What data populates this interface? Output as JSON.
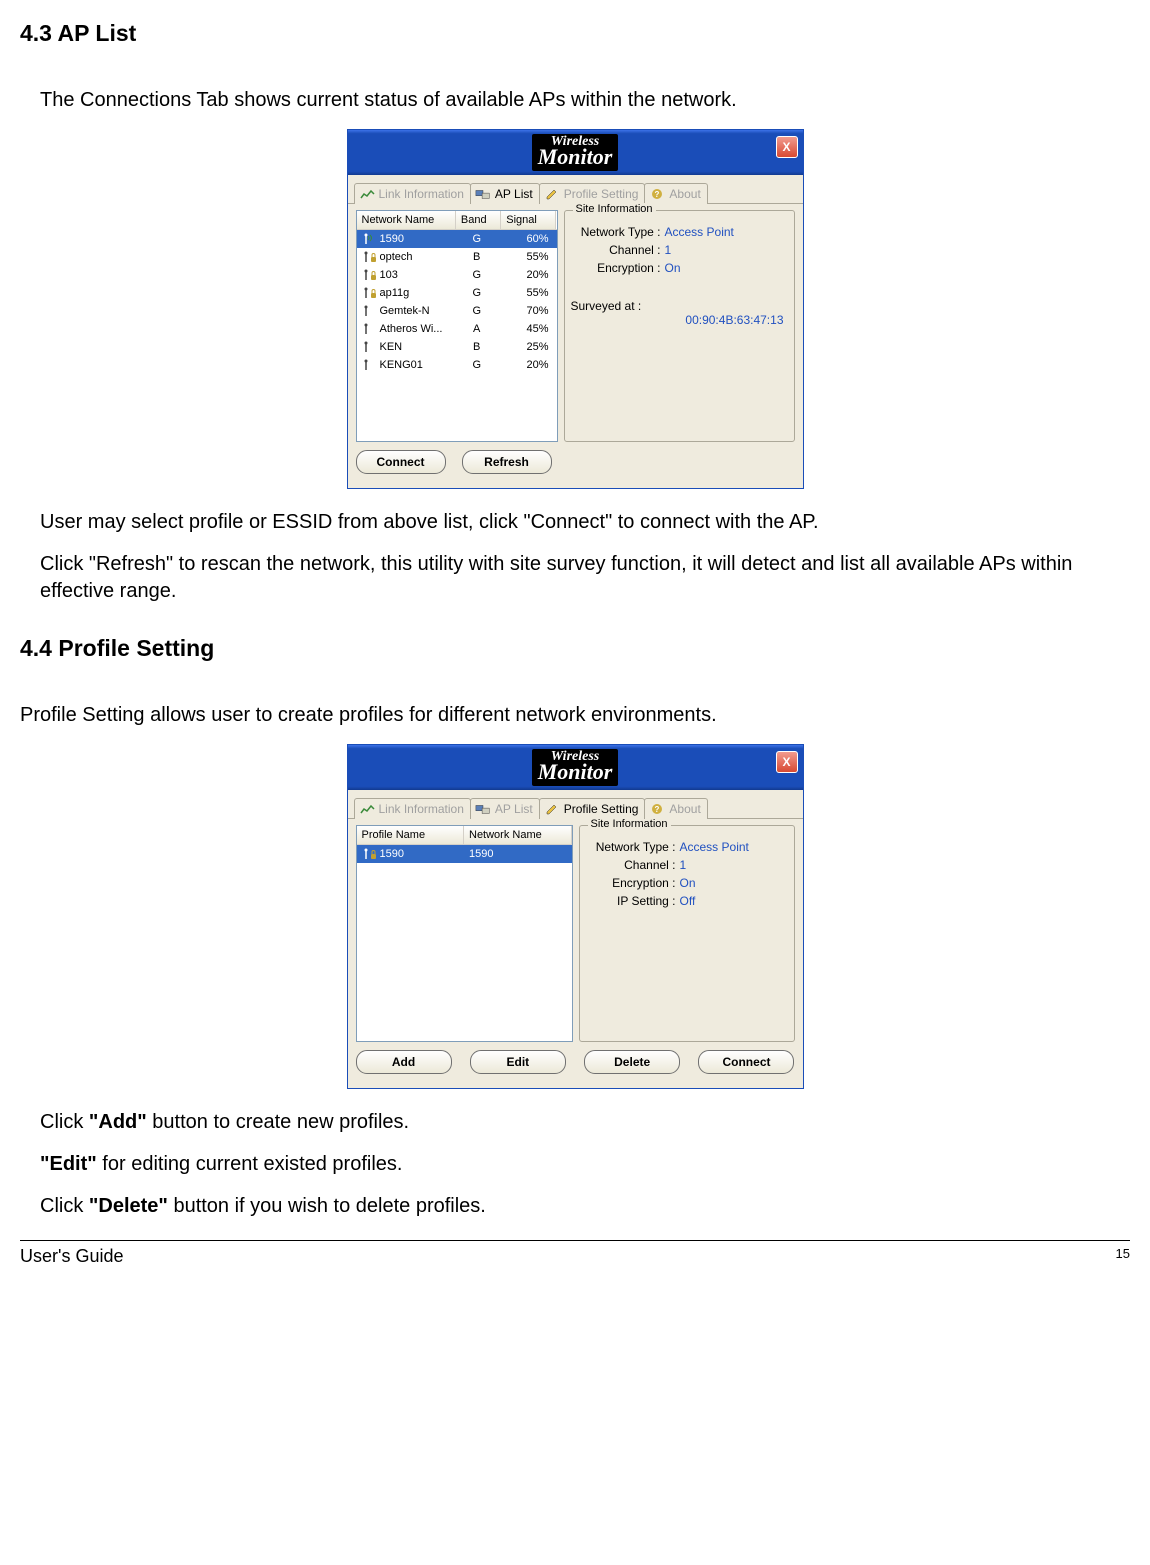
{
  "section43": {
    "heading": "4.3 AP List",
    "intro": "The Connections Tab shows current status of available APs within the network.",
    "post1": "User may select profile or ESSID from above list, click \"Connect\" to connect with the AP.",
    "post2": "Click \"Refresh\" to rescan the network, this utility with site survey function, it will detect and list all available APs within effective range."
  },
  "section44": {
    "heading": "4.4 Profile Setting",
    "intro": "Profile Setting allows user to create profiles for different network environments.",
    "post1_pre": "Click ",
    "post1_bold": "\"Add\"",
    "post1_post": " button to create new profiles.",
    "post2_bold": "\"Edit\"",
    "post2_post": " for editing current existed profiles.",
    "post3_pre": "Click ",
    "post3_bold": "\"Delete\"",
    "post3_post": " button if you wish to delete profiles."
  },
  "app": {
    "logo_line1": "Wireless",
    "logo_line2": "Monitor",
    "close": "X",
    "tabs": {
      "link_info": "Link Information",
      "ap_list": "AP List",
      "profile_setting": "Profile Setting",
      "about": "About"
    },
    "site_info_legend": "Site Information",
    "labels": {
      "network_type": "Network Type :",
      "channel": "Channel :",
      "encryption": "Encryption :",
      "ip_setting": "IP Setting :",
      "surveyed_at": "Surveyed at :"
    }
  },
  "ap_list": {
    "headers": {
      "name": "Network Name",
      "band": "Band",
      "signal": "Signal"
    },
    "rows": [
      {
        "name": "1590",
        "band": "G",
        "signal": "60%",
        "locked": false,
        "active": true,
        "selected": true
      },
      {
        "name": "optech",
        "band": "B",
        "signal": "55%",
        "locked": true
      },
      {
        "name": "103",
        "band": "G",
        "signal": "20%",
        "locked": true
      },
      {
        "name": "ap11g",
        "band": "G",
        "signal": "55%",
        "locked": true
      },
      {
        "name": "Gemtek-N",
        "band": "G",
        "signal": "70%",
        "locked": false
      },
      {
        "name": "Atheros Wi...",
        "band": "A",
        "signal": "45%",
        "locked": false
      },
      {
        "name": "KEN",
        "band": "B",
        "signal": "25%",
        "locked": false
      },
      {
        "name": "KENG01",
        "band": "G",
        "signal": "20%",
        "locked": false
      }
    ],
    "site": {
      "network_type": "Access Point",
      "channel": "1",
      "encryption": "On",
      "surveyed_mac": "00:90:4B:63:47:13"
    },
    "buttons": {
      "connect": "Connect",
      "refresh": "Refresh"
    }
  },
  "profile": {
    "headers": {
      "profile": "Profile Name",
      "network": "Network Name"
    },
    "rows": [
      {
        "profile": "1590",
        "network": "1590",
        "locked": true,
        "selected": true
      }
    ],
    "site": {
      "network_type": "Access Point",
      "channel": "1",
      "encryption": "On",
      "ip_setting": "Off"
    },
    "buttons": {
      "add": "Add",
      "edit": "Edit",
      "delete": "Delete",
      "connect": "Connect"
    }
  },
  "footer": {
    "guide": "User's Guide",
    "page": "15"
  }
}
